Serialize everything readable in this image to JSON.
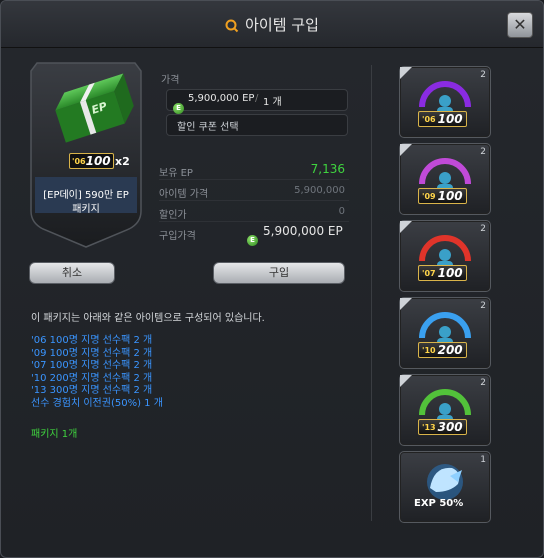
{
  "window": {
    "title": "아이템 구입",
    "close_label": "✕"
  },
  "product": {
    "name_line1": "[EP데이] 590만 EP",
    "name_line2": "패키지",
    "box_badge_year": "'06",
    "box_badge_value": "100",
    "box_multiplier": "x2",
    "box_logo": "EP"
  },
  "price": {
    "label": "가격",
    "amount": "5,900,000 EP",
    "separator": "/",
    "quantity": "1 개",
    "coupon_placeholder": "할인 쿠폰 선택",
    "coin_symbol": "E"
  },
  "summary": [
    {
      "label": "보유 EP",
      "value": "7,136",
      "color": "#3fd33f"
    },
    {
      "label": "아이템 가격",
      "value": "5,900,000",
      "color": "#6f757c"
    },
    {
      "label": "할인가",
      "value": "0",
      "color": "#6f757c"
    }
  ],
  "purchase_total": {
    "label": "구입가격",
    "value": "5,900,000 EP"
  },
  "buttons": {
    "cancel": "취소",
    "buy": "구입"
  },
  "description": "이 패키지는 아래와 같은 아이템으로 구성되어 있습니다.",
  "contents": [
    "'06 100명 지명 선수팩 2 개",
    "'09 100명 지명 선수팩 2 개",
    "'07 100명 지명 선수팩 2 개",
    "'10 200명 지명 선수팩 2 개",
    "'13 300명 지명 선수팩 2 개",
    "선수 경험치 이전권(50%) 1 개"
  ],
  "package_count": "패키지 1개",
  "slots": [
    {
      "year": "'06",
      "value": "100",
      "count": "2",
      "ring_color": "#8a2be2"
    },
    {
      "year": "'09",
      "value": "100",
      "count": "2",
      "ring_color": "#c04ad8"
    },
    {
      "year": "'07",
      "value": "100",
      "count": "2",
      "ring_color": "#e0342a"
    },
    {
      "year": "'10",
      "value": "200",
      "count": "2",
      "ring_color": "#3aa0f0"
    },
    {
      "year": "'13",
      "value": "300",
      "count": "2",
      "ring_color": "#52c23a"
    }
  ],
  "exp_slot": {
    "label": "EXP 50%",
    "count": "1"
  }
}
